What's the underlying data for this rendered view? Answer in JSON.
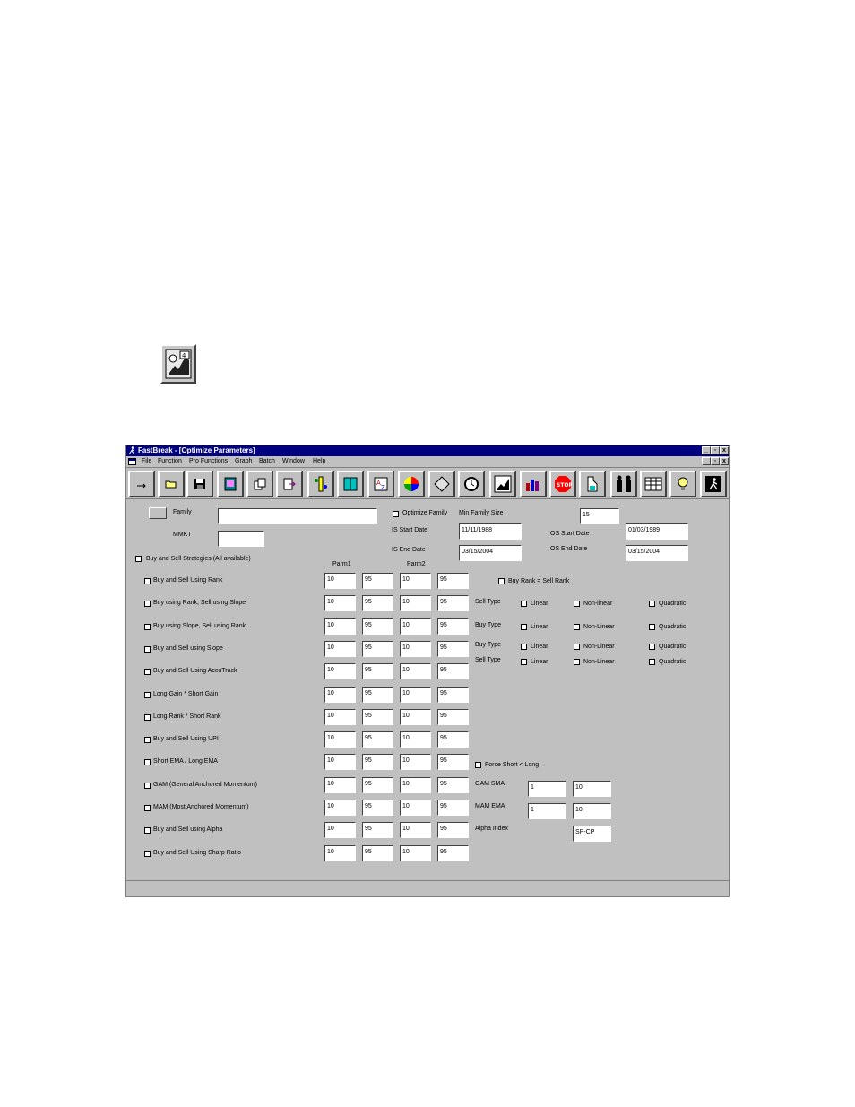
{
  "window": {
    "title": "FastBreak - [Optimize Parameters]",
    "controls": [
      "_",
      "▫",
      "x"
    ]
  },
  "menu": [
    "File",
    "Function",
    "Pro Functions",
    "Graph",
    "Batch",
    "Window",
    "Help"
  ],
  "toolbar_icons": [
    "minimize-arrow",
    "open-folder",
    "save-disk",
    "chart-book",
    "copy",
    "export",
    "traffic",
    "book",
    "a-to-z",
    "color-wheel",
    "diamond",
    "watch",
    "run",
    "bars",
    "stop",
    "jug",
    "people",
    "table",
    "lightbulb",
    "exit-runner"
  ],
  "form": {
    "family_label": "Family",
    "family_value": "",
    "mmkt_label": "MMKT",
    "mmkt_value": "",
    "optimize_family_label": "Optimize Family",
    "min_family_size_label": "Min Family Size",
    "min_family_size_value": "15",
    "is_start_label": "IS Start Date",
    "is_start_value": "11/11/1988",
    "is_end_label": "IS End Date",
    "is_end_value": "03/15/2004",
    "os_start_label": "OS Start Date",
    "os_start_value": "01/03/1989",
    "os_end_label": "OS End Date",
    "os_end_value": "03/15/2004",
    "all_strategies_label": "Buy and Sell Strategies (All available)",
    "parm1_label": "Parm1",
    "parm2_label": "Parm2"
  },
  "strategies": [
    {
      "label": "Buy and Sell Using Rank",
      "v": [
        "10",
        "95",
        "10",
        "95"
      ]
    },
    {
      "label": "Buy using Rank, Sell using Slope",
      "v": [
        "10",
        "95",
        "10",
        "95"
      ]
    },
    {
      "label": "Buy using Slope, Sell using Rank",
      "v": [
        "10",
        "95",
        "10",
        "95"
      ]
    },
    {
      "label": "Buy and Sell using Slope",
      "v": [
        "10",
        "95",
        "10",
        "95"
      ]
    },
    {
      "label": "Buy and Sell Using AccuTrack",
      "v": [
        "10",
        "95",
        "10",
        "95"
      ]
    },
    {
      "label": "Long Gain * Short Gain",
      "v": [
        "10",
        "95",
        "10",
        "95"
      ]
    },
    {
      "label": "Long Rank * Short Rank",
      "v": [
        "10",
        "95",
        "10",
        "95"
      ]
    },
    {
      "label": "Buy and Sell Using UPI",
      "v": [
        "10",
        "95",
        "10",
        "95"
      ]
    },
    {
      "label": "Short EMA / Long EMA",
      "v": [
        "10",
        "95",
        "10",
        "95"
      ]
    },
    {
      "label": "GAM (General Anchored Momentum)",
      "v": [
        "10",
        "95",
        "10",
        "95"
      ]
    },
    {
      "label": "MAM (Most Anchored Momentum)",
      "v": [
        "10",
        "95",
        "10",
        "95"
      ]
    },
    {
      "label": "Buy and Sell using Alpha",
      "v": [
        "10",
        "95",
        "10",
        "95"
      ]
    },
    {
      "label": "Buy and Sell Using Sharp Ratio",
      "v": [
        "10",
        "95",
        "10",
        "95"
      ]
    }
  ],
  "right": {
    "buy_rank_sell_rank": "Buy Rank = Sell Rank",
    "types": [
      {
        "label": "Sell Type",
        "opts": [
          "Linear",
          "Non-linear",
          "Quadratic"
        ]
      },
      {
        "label": "Buy Type",
        "opts": [
          "Linear",
          "Non-Linear",
          "Quadratic"
        ]
      },
      {
        "label": "Buy Type",
        "opts": [
          "Linear",
          "Non-Linear",
          "Quadratic"
        ]
      },
      {
        "label": "Sell Type",
        "opts": [
          "Linear",
          "Non-Linear",
          "Quadratic"
        ]
      }
    ],
    "force_short_long": "Force Short < Long",
    "gam_sma_label": "GAM SMA",
    "gam_sma": [
      "1",
      "10"
    ],
    "mam_ema_label": "MAM EMA",
    "mam_ema": [
      "1",
      "10"
    ],
    "alpha_index_label": "Alpha Index",
    "alpha_index": "SP-CP"
  }
}
